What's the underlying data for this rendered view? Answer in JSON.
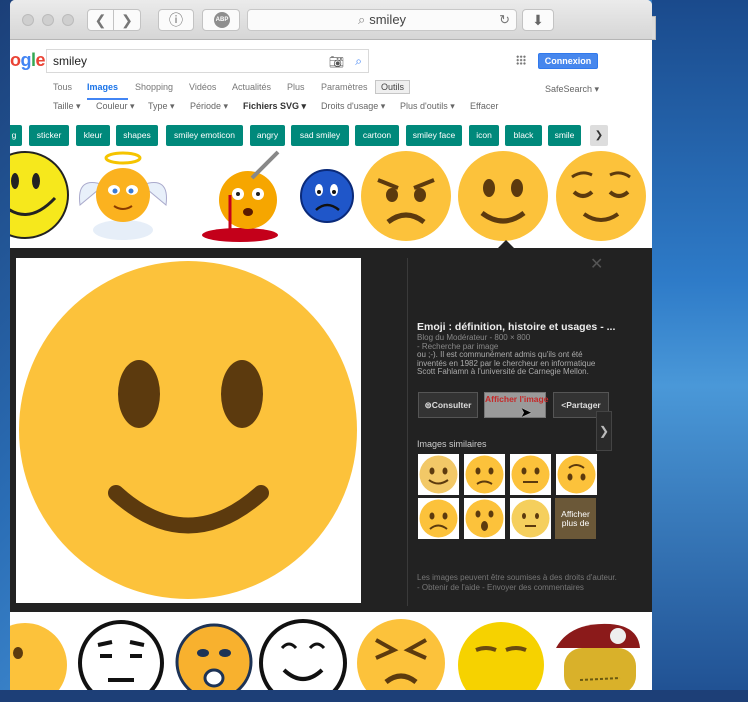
{
  "browser": {
    "address_text": "smiley",
    "abp_label": "ABP",
    "new_tab": "+"
  },
  "google": {
    "logo_text": "ogle",
    "query": "smiley",
    "connexion": "Connexion",
    "tabs": [
      "Tous",
      "Images",
      "Shopping",
      "Vidéos",
      "Actualités",
      "Plus",
      "Paramètres",
      "Outils"
    ],
    "safesearch": "SafeSearch ▾",
    "filters": [
      "Taille ▾",
      "Couleur ▾",
      "Type ▾",
      "Période ▾",
      "Fichiers SVG ▾",
      "Droits d'usage ▾",
      "Plus d'outils ▾",
      "Effacer"
    ],
    "chips": [
      "g",
      "sticker",
      "kleur",
      "shapes",
      "smiley emoticon",
      "angry",
      "sad smiley",
      "cartoon",
      "smiley face",
      "icon",
      "black",
      "smile"
    ]
  },
  "panel": {
    "title": "Emoji : définition, histoire et usages - ...",
    "meta_line1": "Blog du Modérateur - 800 × 800",
    "meta_line2": " - Recherche par image",
    "description": "ou ;-). Il est communément admis qu'ils ont été inventés en 1982 par le chercheur en informatique Scott Fahlamn à l'université de Carnegie Mellon.",
    "btn_consulter": "Consulter",
    "btn_afficher": "Afficher l'image",
    "btn_partager": "Partager",
    "similar_label": "Images similaires",
    "similar_more": "Afficher plus de",
    "legal": "Les images peuvent être soumises à des droits d'auteur. - Obtenir de l'aide - Envoyer des commentaires"
  },
  "colors": {
    "smiley_yellow": "#fcc23b",
    "eye_brown": "#5c3a0e",
    "chip_teal": "#00897b",
    "connexion_blue": "#4787ed",
    "panel_bg": "#222222"
  }
}
